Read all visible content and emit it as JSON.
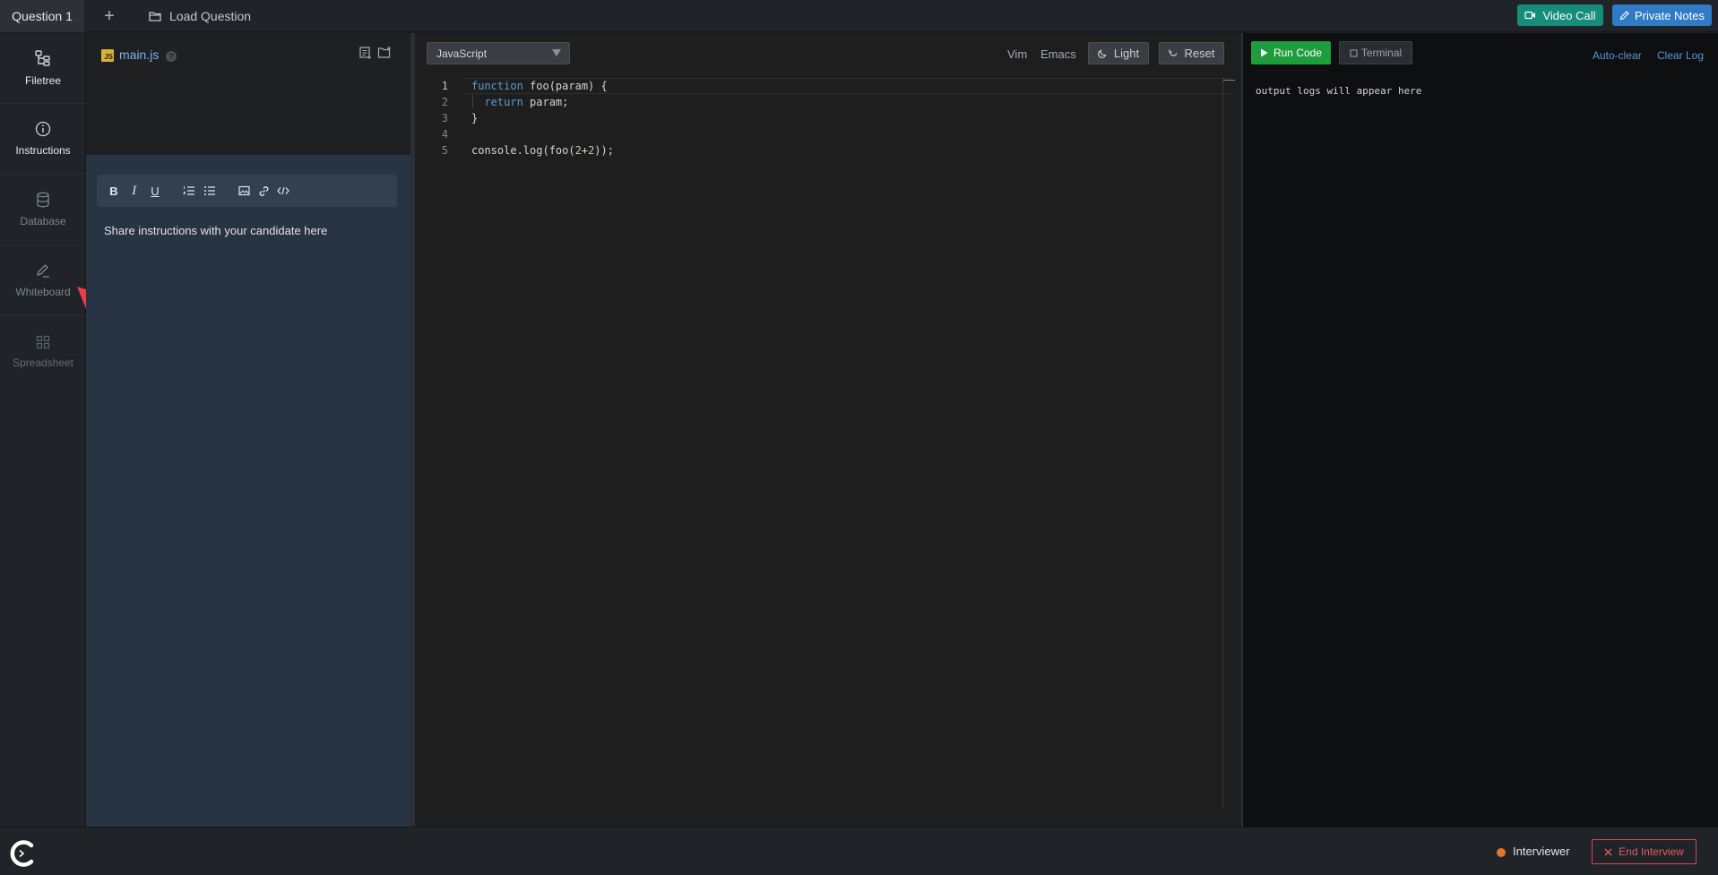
{
  "topbar": {
    "active_tab": "Question 1",
    "add_tab": "+",
    "load_question": "Load Question",
    "video_call": "Video Call",
    "private_notes": "Private Notes"
  },
  "rail": {
    "filetree": "Filetree",
    "instructions": "Instructions",
    "database": "Database",
    "whiteboard": "Whiteboard",
    "spreadsheet": "Spreadsheet"
  },
  "file_panel": {
    "file_badge": "JS",
    "file_name": "main.js",
    "help": "?"
  },
  "instructions": {
    "placeholder_text": "Share instructions with your candidate here",
    "toolbar": {
      "bold": "B",
      "italic": "I",
      "underline": "U"
    }
  },
  "editor": {
    "language": "JavaScript",
    "vim": "Vim",
    "emacs": "Emacs",
    "light": "Light",
    "reset": "Reset",
    "line_numbers": [
      "1",
      "2",
      "3",
      "4",
      "5"
    ],
    "lines": [
      {
        "kw": "function",
        "rest": " foo(param) {"
      },
      {
        "pre": "  ",
        "kw": "return",
        "rest": " param;"
      },
      {
        "rest": "}"
      },
      {
        "rest": ""
      },
      {
        "pre": "console.log(foo(",
        "n1": "2",
        "op": "+",
        "n2": "2",
        "post": "));"
      }
    ]
  },
  "output": {
    "run_code": "Run Code",
    "terminal": "Terminal",
    "auto_clear": "Auto-clear",
    "clear_log": "Clear Log",
    "log_placeholder": "output logs will appear here"
  },
  "bottombar": {
    "role": "Interviewer",
    "end_interview": "End Interview"
  },
  "colors": {
    "accent_green": "#1f9d3e",
    "accent_teal": "#168c7a",
    "accent_blue": "#2f7bc4",
    "status_orange": "#e3752c",
    "danger_red": "#d64a4a"
  }
}
